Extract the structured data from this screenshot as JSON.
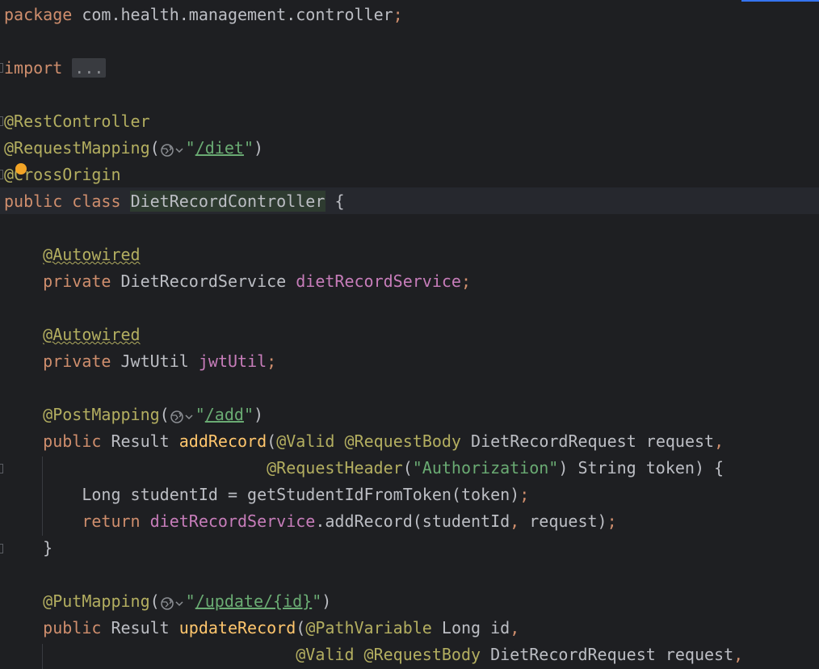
{
  "editor": {
    "language": "Java",
    "lines": {
      "l1": {
        "kw": "package",
        "rest": " com.health.management.controller",
        "semi": ";"
      },
      "l3": {
        "kw": "import",
        "fold": "..."
      },
      "l5": {
        "annotation": "@RestController"
      },
      "l6": {
        "annotation": "@RequestMapping",
        "open": "(",
        "q1": "\"",
        "url": "/diet",
        "q2": "\"",
        "close": ")"
      },
      "l7": {
        "annotation": "@CrossOrigin"
      },
      "l8": {
        "kw1": "public",
        "kw2": "class",
        "classname": "DietRecordController",
        "brace": "{"
      },
      "l10": {
        "annotation": "@Autowired"
      },
      "l11": {
        "kw": "private",
        "type": "DietRecordService",
        "field": "dietRecordService",
        "semi": ";"
      },
      "l13": {
        "annotation": "@Autowired"
      },
      "l14": {
        "kw": "private",
        "type": "JwtUtil",
        "field": "jwtUtil",
        "semi": ";"
      },
      "l16": {
        "annotation": "@PostMapping",
        "open": "(",
        "q1": "\"",
        "url": "/add",
        "q2": "\"",
        "close": ")"
      },
      "l17": {
        "kw": "public",
        "type": "Result",
        "method": "addRecord",
        "open": "(",
        "a1": "@Valid",
        "a2": "@RequestBody",
        "ptype": "DietRecordRequest",
        "pname": "request",
        "comma": ","
      },
      "l18": {
        "a1": "@RequestHeader",
        "open": "(",
        "str": "\"Authorization\"",
        "close": ")",
        "ptype": "String",
        "pname": "token",
        "end": ") {"
      },
      "l19": {
        "type": "Long",
        "var": "studentId",
        "eq": " = ",
        "call": "getStudentIdFromToken",
        "args": "(token)",
        "semi": ";"
      },
      "l20": {
        "kw": "return",
        "field": "dietRecordService",
        "call": ".addRecord(studentId",
        "comma": ",",
        "arg2": " request)",
        "semi": ";"
      },
      "l21": {
        "brace": "}"
      },
      "l23": {
        "annotation": "@PutMapping",
        "open": "(",
        "q1": "\"",
        "url": "/update/{id}",
        "q2": "\"",
        "close": ")"
      },
      "l24": {
        "kw": "public",
        "type": "Result",
        "method": "updateRecord",
        "open": "(",
        "a1": "@PathVariable",
        "ptype": "Long",
        "pname": "id",
        "comma": ","
      },
      "l25": {
        "a1": "@Valid",
        "a2": "@RequestBody",
        "ptype": "DietRecordRequest",
        "pname": "request",
        "comma": ","
      }
    },
    "icons": {
      "web_url": "globe-dropdown-icon",
      "intention": "intention-bulb-icon"
    },
    "colors": {
      "background": "#1e1f22",
      "keyword": "#cf8e6d",
      "annotation": "#b3ae60",
      "method": "#ffc66d",
      "field": "#c77dba",
      "string": "#6aab73",
      "plain": "#bcbec4",
      "accent": "#3574f0"
    }
  }
}
